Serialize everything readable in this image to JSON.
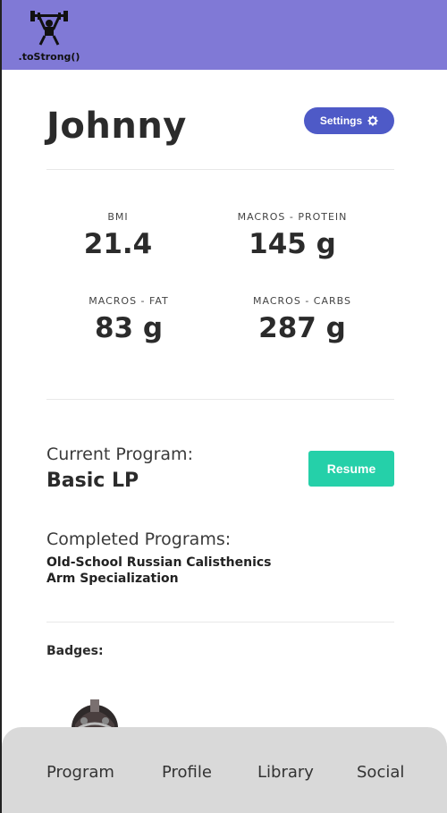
{
  "header": {
    "logo_text": ".toStrong()",
    "bg_color": "#8079d6"
  },
  "profile": {
    "name": "Johnny",
    "settings_label": "Settings",
    "settings_icon": "gear-icon"
  },
  "stats": [
    {
      "label": "BMI",
      "value": "21.4"
    },
    {
      "label": "MACROS - PROTEIN",
      "value": "145 g"
    },
    {
      "label": "MACROS - FAT",
      "value": "83 g"
    },
    {
      "label": "MACROS - CARBS",
      "value": "287 g"
    }
  ],
  "program": {
    "current_label": "Current Program:",
    "current_name": "Basic LP",
    "resume_label": "Resume",
    "completed_label": "Completed Programs:",
    "completed": [
      "Old-School Russian Calisthenics",
      "Arm Specialization"
    ]
  },
  "badges": {
    "label": "Badges:",
    "items": [
      "helmet-badge-icon"
    ]
  },
  "nav": {
    "items": [
      "Program",
      "Profile",
      "Library",
      "Social"
    ]
  },
  "colors": {
    "accent": "#4e5ac7",
    "resume": "#25d0a9",
    "nav_bg": "#d9d9d9"
  }
}
